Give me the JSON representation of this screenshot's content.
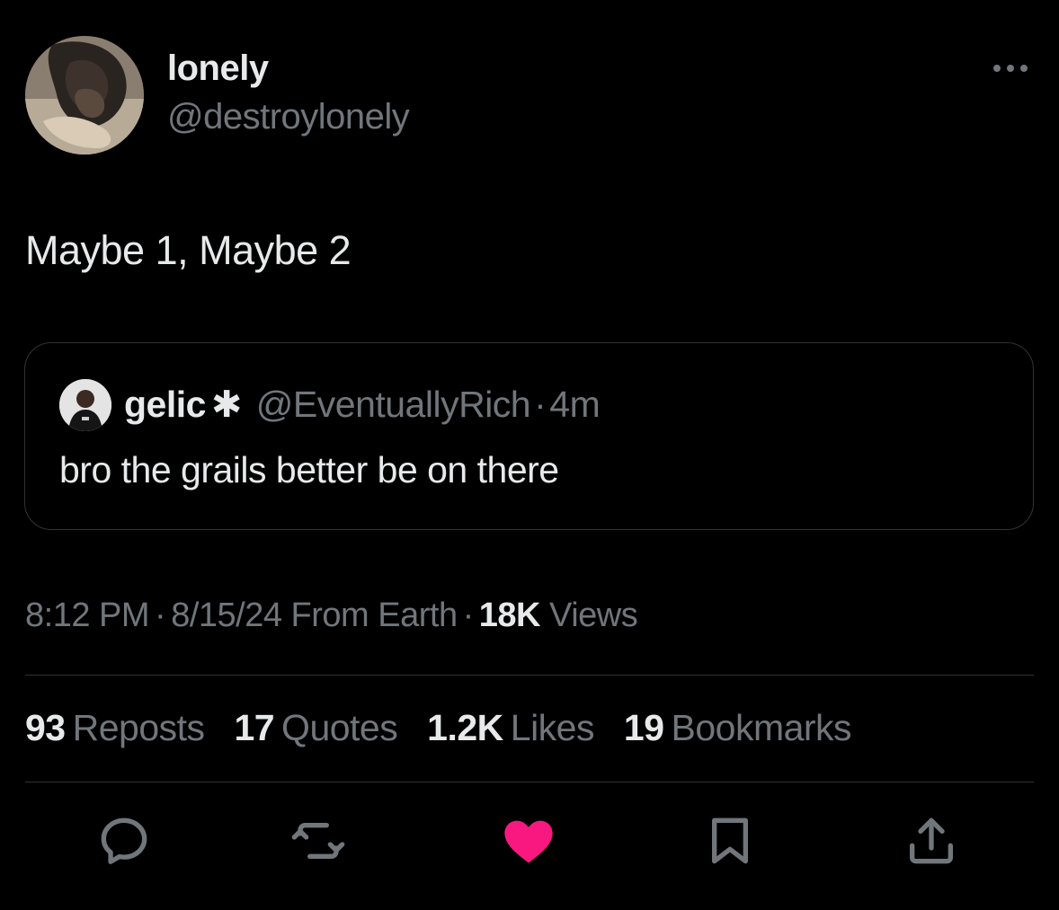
{
  "author": {
    "name": "lonely",
    "handle": "@destroylonely"
  },
  "tweet": {
    "text": "Maybe 1, Maybe 2"
  },
  "quoted": {
    "name": "gelic",
    "badge": "✱",
    "handle": "@EventuallyRich",
    "separator": "·",
    "time": "4m",
    "text": "bro the grails better be on there"
  },
  "meta": {
    "time": "8:12 PM",
    "date": "8/15/24",
    "source": "From Earth",
    "separator": "·",
    "views_count": "18K",
    "views_label": "Views"
  },
  "stats": {
    "reposts": {
      "count": "93",
      "label": "Reposts"
    },
    "quotes": {
      "count": "17",
      "label": "Quotes"
    },
    "likes": {
      "count": "1.2K",
      "label": "Likes"
    },
    "bookmarks": {
      "count": "19",
      "label": "Bookmarks"
    }
  },
  "actions": {
    "reply_icon": "reply-icon",
    "repost_icon": "repost-icon",
    "like_icon": "heart-filled-icon",
    "bookmark_icon": "bookmark-icon",
    "share_icon": "share-icon"
  },
  "colors": {
    "background": "#000000",
    "text_primary": "#e7e9ea",
    "text_secondary": "#71767b",
    "border": "#2f3336",
    "like_active": "#f91880"
  }
}
